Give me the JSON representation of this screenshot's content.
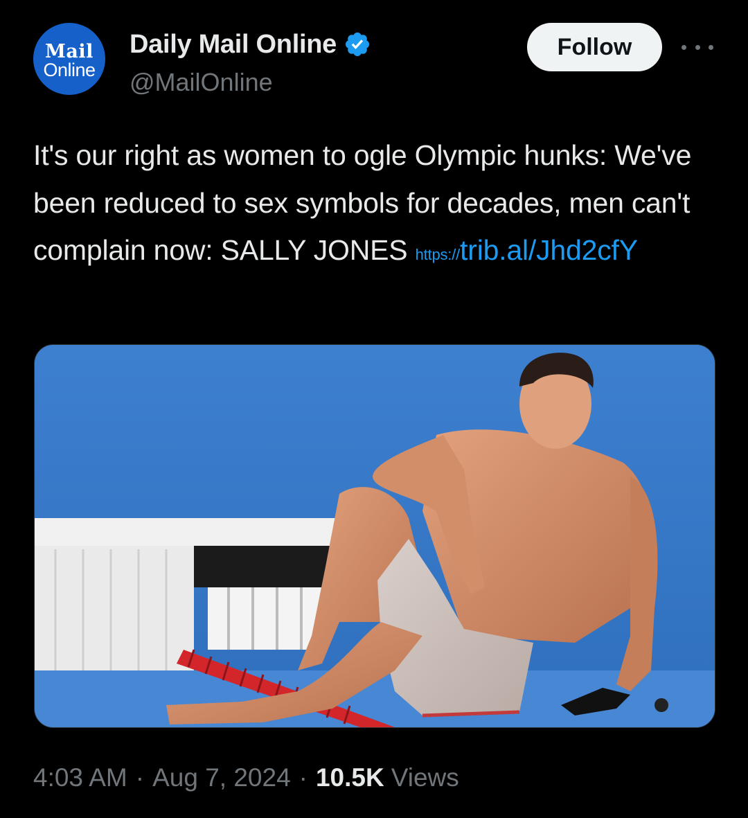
{
  "author": {
    "avatar_line1": "Mail",
    "avatar_line2": "Online",
    "display_name": "Daily Mail Online",
    "handle": "@MailOnline",
    "verified": true
  },
  "actions": {
    "follow_label": "Follow"
  },
  "tweet": {
    "text": "It's our right as women to ogle Olympic hunks: We've been reduced to sex symbols for decades, men can't complain now: SALLY JONES ",
    "link_prefix": "https://",
    "link_text": "trib.al/Jhd2cfY"
  },
  "meta": {
    "time": "4:03 AM",
    "date": "Aug 7, 2024",
    "views_count": "10.5K",
    "views_label": "Views",
    "separator": "·"
  },
  "colors": {
    "background": "#000000",
    "text": "#e7e9ea",
    "secondary": "#71767b",
    "link": "#1d9bf0",
    "avatar_bg": "#1560c9"
  },
  "icons": {
    "verified": "verified-badge-icon",
    "more": "more-horizontal-icon"
  }
}
